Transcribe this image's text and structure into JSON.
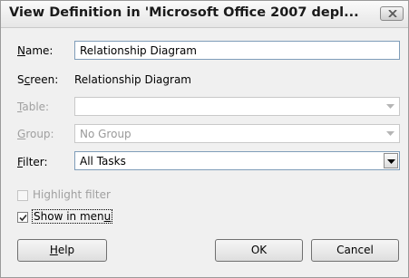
{
  "dialog": {
    "title": "View Definition in 'Microsoft Office 2007 depl...",
    "close_icon": "close-x-icon"
  },
  "form": {
    "name": {
      "label_mn": "N",
      "label_rest": "ame:",
      "value": "Relationship Diagram"
    },
    "screen": {
      "label_pre": "S",
      "label_mn": "c",
      "label_rest": "reen:",
      "value": "Relationship Diagram"
    },
    "table": {
      "label_mn": "T",
      "label_rest": "able:",
      "value": ""
    },
    "group": {
      "label_mn": "G",
      "label_rest": "roup:",
      "value": "No Group"
    },
    "filter": {
      "label_mn": "F",
      "label_rest": "ilter:",
      "value": "All Tasks"
    }
  },
  "options": {
    "highlight_filter": {
      "label": "Highlight filter",
      "checked": false,
      "enabled": false
    },
    "show_in_menu": {
      "label_pre": "Show in men",
      "label_mn": "u",
      "checked": true
    }
  },
  "buttons": {
    "help": {
      "label_mn": "H",
      "label_rest": "elp"
    },
    "ok": "OK",
    "cancel": "Cancel"
  }
}
